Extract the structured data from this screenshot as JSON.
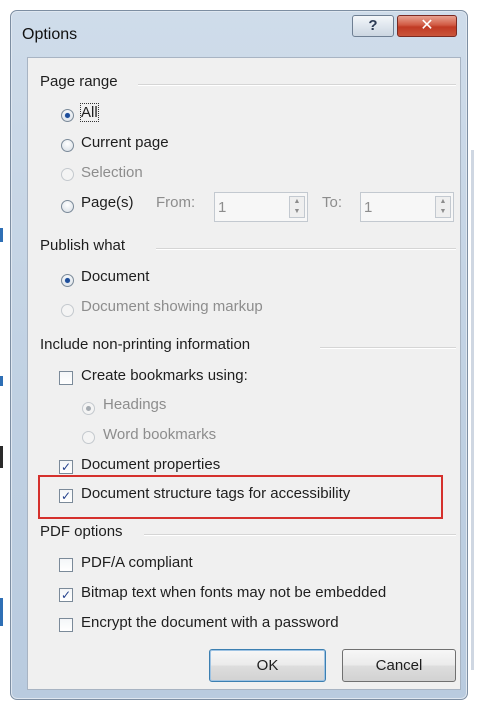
{
  "dialog": {
    "title": "Options",
    "help_label": "?",
    "close_label": "✕"
  },
  "page_range": {
    "header": "Page range",
    "all_label": "All",
    "current_page_label": "Current page",
    "selection_label": "Selection",
    "pages_label": "Page(s)",
    "from_label": "From:",
    "from_value": "1",
    "to_label": "To:",
    "to_value": "1",
    "selected": "All"
  },
  "publish_what": {
    "header": "Publish what",
    "document_label": "Document",
    "document_markup_label": "Document showing markup",
    "selected": "Document"
  },
  "non_printing": {
    "header": "Include non-printing information",
    "create_bookmarks_label": "Create bookmarks using:",
    "create_bookmarks_checked": false,
    "headings_label": "Headings",
    "word_bookmarks_label": "Word bookmarks",
    "bookmark_source_selected": "Headings",
    "document_properties_label": "Document properties",
    "document_properties_checked": true,
    "structure_tags_label": "Document structure tags for accessibility",
    "structure_tags_checked": true
  },
  "pdf_options": {
    "header": "PDF options",
    "pdfa_label": "PDF/A compliant",
    "pdfa_checked": false,
    "bitmap_label": "Bitmap text when fonts may not be embedded",
    "bitmap_checked": true,
    "encrypt_label": "Encrypt the document with a password",
    "encrypt_checked": false
  },
  "buttons": {
    "ok_label": "OK",
    "cancel_label": "Cancel"
  },
  "colors": {
    "highlight": "#d5302c",
    "title_bar": "#c5d5e6",
    "close_button": "#c9452f"
  }
}
